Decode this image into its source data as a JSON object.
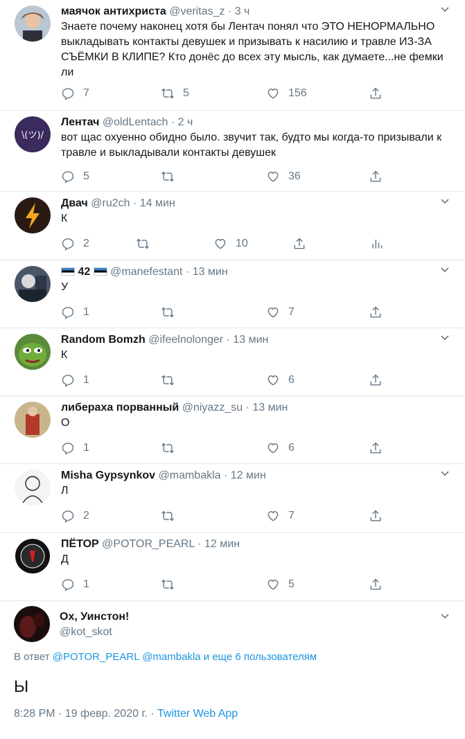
{
  "tweets": [
    {
      "name": "маячок антихриста",
      "handle": "@veritas_z",
      "time": "3 ч",
      "text": "Знаете почему наконец хотя бы Лентач понял что ЭТО НЕНОРМАЛЬНО выкладывать контакты девушек и призывать к насилию и травле ИЗ-ЗА СЪЁМКИ В КЛИПЕ? Кто донёс до всех эту мысль, как думаете...не фемки ли",
      "replies": "7",
      "retweets": "5",
      "likes": "156"
    },
    {
      "name": "Лентач",
      "handle": "@oldLentach",
      "time": "2 ч",
      "avatar_text": "\\(ツ)/",
      "text": "вот щас охуенно обидно было. звучит так, будто мы когда-то призывали к травле и выкладывали контакты девушек",
      "replies": "5",
      "retweets": "",
      "likes": "36"
    },
    {
      "name": "Двач",
      "handle": "@ru2ch",
      "time": "14 мин",
      "text": "К",
      "replies": "2",
      "retweets": "",
      "likes": "10"
    },
    {
      "name": "42",
      "handle": "@manefestant",
      "time": "13 мин",
      "text": "У",
      "replies": "1",
      "retweets": "",
      "likes": "7"
    },
    {
      "name": "Random Bomzh",
      "handle": "@ifeelnolonger",
      "time": "13 мин",
      "text": "К",
      "replies": "1",
      "retweets": "",
      "likes": "6"
    },
    {
      "name": "либераха порванный",
      "handle": "@niyazz_su",
      "time": "13 мин",
      "text": "О",
      "replies": "1",
      "retweets": "",
      "likes": "6"
    },
    {
      "name": "Misha Gypsynkov",
      "handle": "@mambakla",
      "time": "12 мин",
      "text": "Л",
      "replies": "2",
      "retweets": "",
      "likes": "7"
    },
    {
      "name": "ПЁТОР",
      "handle": "@POTOR_PEARL",
      "time": "12 мин",
      "text": "Д",
      "replies": "1",
      "retweets": "",
      "likes": "5"
    }
  ],
  "main": {
    "name": "Ох, Уинстон!",
    "handle": "@kot_skot",
    "reply_prefix": "В ответ",
    "mention1": "@POTOR_PEARL",
    "mention2": "@mambakla",
    "mention_rest": "и еще 6 пользователям",
    "text": "Ы",
    "timestamp": "8:28 PM · 19 февр. 2020 г. ·",
    "app": "Twitter Web App"
  },
  "colors": {
    "link": "#1b95e0",
    "muted": "#657786",
    "text": "#14171a"
  }
}
